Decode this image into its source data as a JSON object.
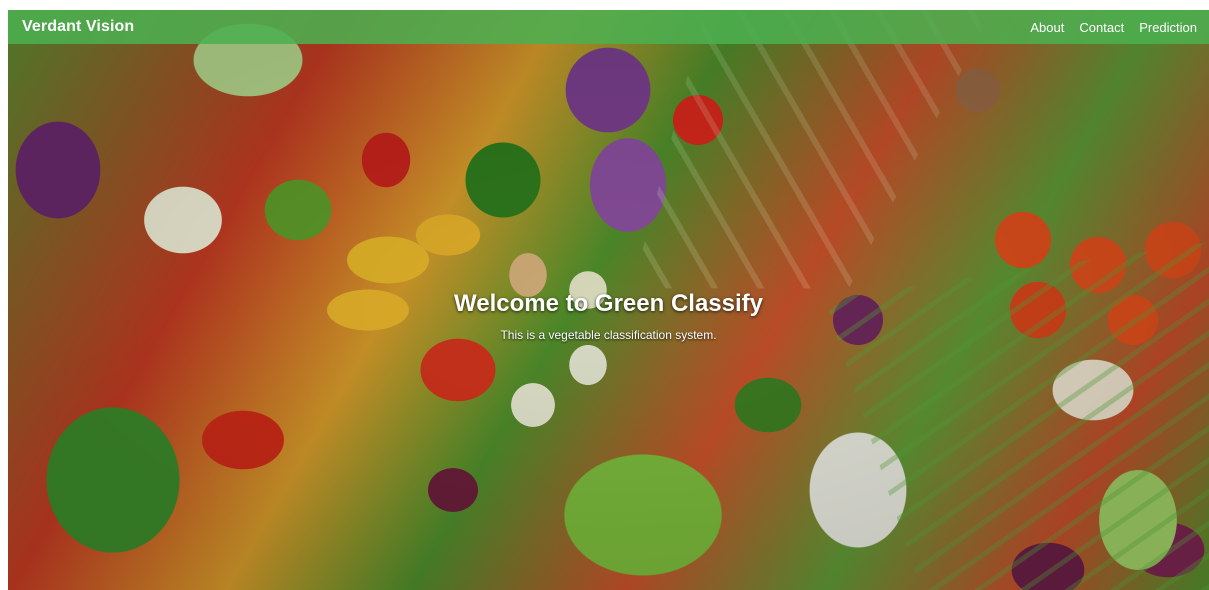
{
  "navbar": {
    "brand": "Verdant Vision",
    "links": [
      {
        "label": "About"
      },
      {
        "label": "Contact"
      },
      {
        "label": "Prediction"
      }
    ],
    "bg_color": "#4caf50"
  },
  "hero": {
    "title": "Welcome to Green Classify",
    "subtitle": "This is a vegetable classification system.",
    "background": "vegetables-photo"
  }
}
